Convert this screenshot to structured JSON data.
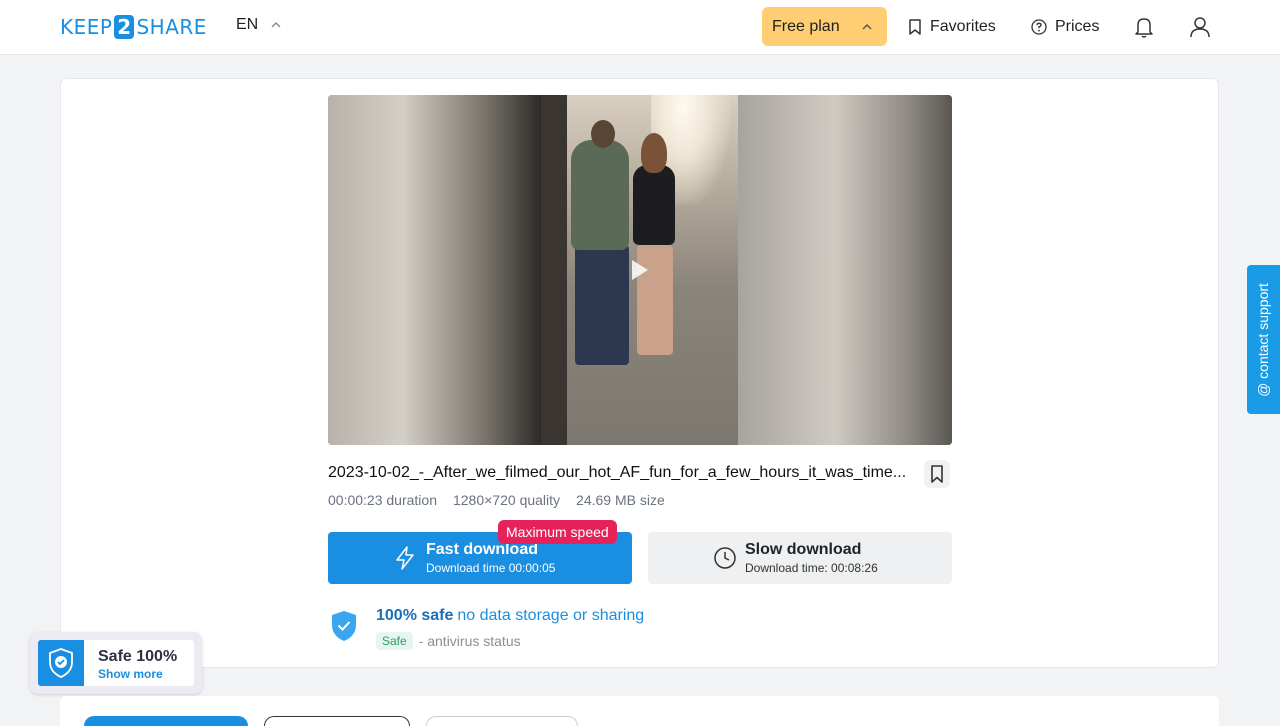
{
  "header": {
    "logo_left": "KEEP",
    "logo_num": "2",
    "logo_right": "SHARE",
    "language": "EN",
    "plan_label": "Free plan",
    "favorites_label": "Favorites",
    "prices_label": "Prices"
  },
  "file": {
    "title": "2023-10-02_-_After_we_filmed_our_hot_AF_fun_for_a_few_hours_it_was_time...",
    "duration": "00:00:23",
    "duration_label": "duration",
    "quality": "1280×720",
    "quality_label": "quality",
    "size": "24.69 MB",
    "size_label": "size"
  },
  "download": {
    "fast_title": "Fast download",
    "fast_time": "Download time 00:00:05",
    "max_speed_badge": "Maximum speed",
    "slow_title": "Slow download",
    "slow_time": "Download time: 00:08:26"
  },
  "safety": {
    "strong": "100% safe",
    "rest": "no data storage or sharing",
    "pill": "Safe",
    "av_text": "- antivirus status"
  },
  "badge": {
    "title": "Safe 100%",
    "link": "Show more"
  },
  "support": {
    "label": "@ contact support"
  },
  "colors": {
    "accent": "#1a8ee0",
    "plan_bg": "#ffce73",
    "max_speed": "#e5225a",
    "safe_pill_bg": "#e4f6ee"
  },
  "icons": {
    "lang_toggle": "chevron-up-icon",
    "plan_toggle": "chevron-up-icon",
    "favorites": "bookmark-icon",
    "prices": "question-circle-icon",
    "notifications": "bell-icon",
    "account": "user-icon",
    "add_favorite": "bookmark-icon",
    "fast": "lightning-icon",
    "slow": "clock-icon",
    "safety": "shield-check-icon",
    "video": "play-icon"
  }
}
